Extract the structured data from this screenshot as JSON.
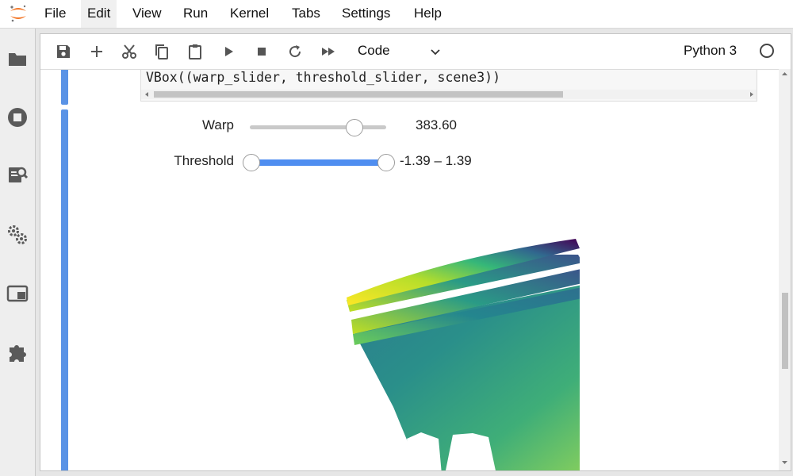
{
  "menubar": {
    "items": [
      "File",
      "Edit",
      "View",
      "Run",
      "Kernel",
      "Tabs",
      "Settings",
      "Help"
    ],
    "active": "Edit",
    "logo_icon": "jupyter-logo"
  },
  "sidebar": {
    "icons": [
      "folder-icon",
      "running-icon",
      "commands-icon",
      "property-inspector-icon",
      "tabs-icon",
      "extension-icon"
    ]
  },
  "toolbar": {
    "buttons": [
      "save-icon",
      "add-icon",
      "cut-icon",
      "copy-icon",
      "paste-icon",
      "run-icon",
      "stop-icon",
      "restart-icon",
      "fast-forward-icon"
    ],
    "cell_type": "Code",
    "kernel": "Python 3"
  },
  "code_cell": {
    "line": "VBox((warp_slider, threshold_slider, scene3))"
  },
  "widgets": {
    "warp": {
      "label": "Warp",
      "readout": "383.60",
      "position_fraction": 0.77
    },
    "threshold": {
      "label": "Threshold",
      "readout": "-1.39 – 1.39",
      "low_fraction": 0.0,
      "high_fraction": 1.0
    }
  },
  "colors": {
    "accent": "#5a93e6",
    "slider_fill": "#4f8ef0",
    "viridis_low": "#440154",
    "viridis_mid": "#21918c",
    "viridis_high": "#fde725"
  }
}
